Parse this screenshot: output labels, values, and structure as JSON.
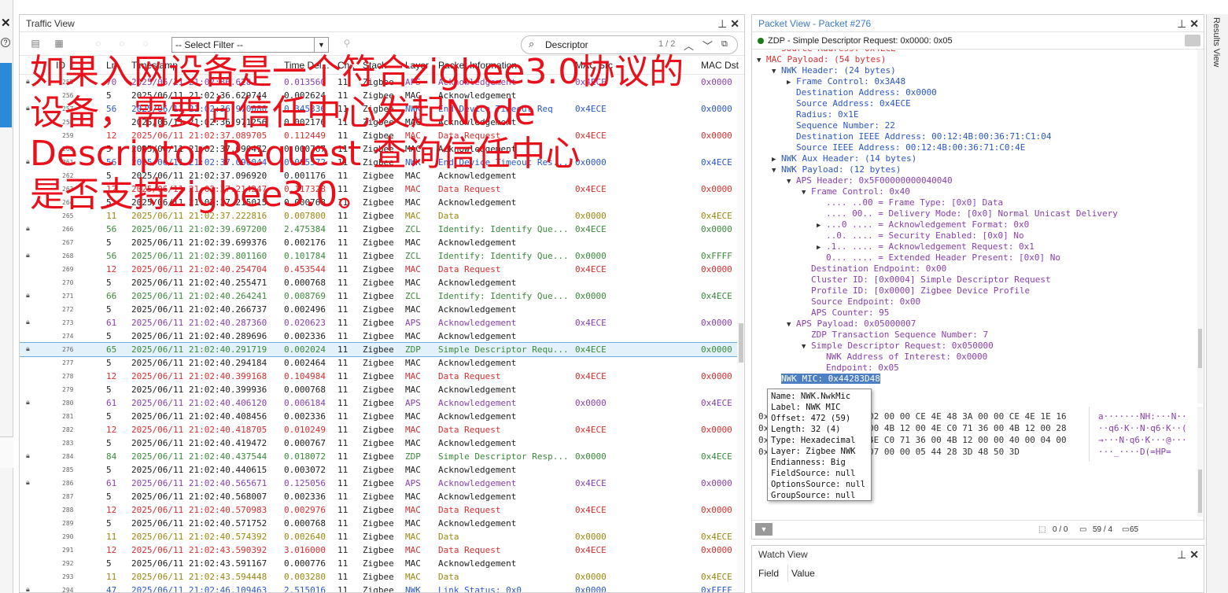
{
  "left_strip": {
    "close_top": "✕",
    "help": "?",
    "close_bottom": "✕"
  },
  "traffic_view": {
    "title": "Traffic View",
    "filter_value": "-- Select Filter --",
    "search_value": "Descriptor",
    "search_count": "1 / 2",
    "columns": [
      "ID",
      "Ln",
      "Timestamp",
      "Time Del...",
      "Ch..",
      "Stack",
      "Layer",
      "Packet Information",
      "MAC Src",
      "MAC Dst"
    ],
    "rows": [
      {
        "id": "255",
        "ln": "70",
        "ts": "2025/06/11 21:02:36.628",
        "td": "0.013560",
        "ch": "11",
        "stack": "Zigbee",
        "layer": "APS",
        "info": "Acknowledgement",
        "src": "0x4ECE",
        "dst": "0x0000",
        "color": "purple",
        "lock": true
      },
      {
        "id": "256",
        "ln": "5",
        "ts": "2025/06/11 21:02:36.629744",
        "td": "0.002624",
        "ch": "11",
        "stack": "Zigbee",
        "layer": "MAC",
        "info": "Acknowledgement",
        "src": "",
        "dst": "",
        "color": "black",
        "lock": false
      },
      {
        "id": "257",
        "ln": "56",
        "ts": "2025/06/11 21:02:36.970080",
        "td": "0.345336",
        "ch": "11",
        "stack": "Zigbee",
        "layer": "NWK",
        "info": "End Device Timeout Req",
        "src": "0x4ECE",
        "dst": "0x0000",
        "color": "blue",
        "lock": true
      },
      {
        "id": "258",
        "ln": "5",
        "ts": "2025/06/11 21:02:36.971256",
        "td": "0.002176",
        "ch": "11",
        "stack": "Zigbee",
        "layer": "MAC",
        "info": "Acknowledgement",
        "src": "",
        "dst": "",
        "color": "black",
        "lock": false
      },
      {
        "id": "259",
        "ln": "12",
        "ts": "2025/06/11 21:02:37.089705",
        "td": "0.112449",
        "ch": "11",
        "stack": "Zigbee",
        "layer": "MAC",
        "info": "Data Request",
        "src": "0x4ECE",
        "dst": "0x0000",
        "color": "red",
        "lock": false
      },
      {
        "id": "260",
        "ln": "5",
        "ts": "2025/06/11 21:02:37.090472",
        "td": "0.000767",
        "ch": "11",
        "stack": "Zigbee",
        "layer": "MAC",
        "info": "Acknowledgement",
        "src": "",
        "dst": "",
        "color": "black",
        "lock": false
      },
      {
        "id": "261",
        "ln": "56",
        "ts": "2025/06/11 21:02:37.096044",
        "td": "0.005572",
        "ch": "11",
        "stack": "Zigbee",
        "layer": "NWK",
        "info": "End Device Timeout Res...",
        "src": "0x0000",
        "dst": "0x4ECE",
        "color": "blue",
        "lock": true
      },
      {
        "id": "262",
        "ln": "5",
        "ts": "2025/06/11 21:02:37.096920",
        "td": "0.001176",
        "ch": "11",
        "stack": "Zigbee",
        "layer": "MAC",
        "info": "Acknowledgement",
        "src": "",
        "dst": "",
        "color": "black",
        "lock": false
      },
      {
        "id": "263",
        "ln": "12",
        "ts": "2025/06/11 21:02:37.214247",
        "td": "0.117328",
        "ch": "11",
        "stack": "Zigbee",
        "layer": "MAC",
        "info": "Data Request",
        "src": "0x4ECE",
        "dst": "0x0000",
        "color": "red",
        "lock": false
      },
      {
        "id": "264",
        "ln": "5",
        "ts": "2025/06/11 21:02:37.215015",
        "td": "0.000768",
        "ch": "11",
        "stack": "Zigbee",
        "layer": "MAC",
        "info": "Acknowledgement",
        "src": "",
        "dst": "",
        "color": "black",
        "lock": false
      },
      {
        "id": "265",
        "ln": "11",
        "ts": "2025/06/11 21:02:37.222816",
        "td": "0.007800",
        "ch": "11",
        "stack": "Zigbee",
        "layer": "MAC",
        "info": "Data",
        "src": "0x0000",
        "dst": "0x4ECE",
        "color": "olive",
        "lock": false
      },
      {
        "id": "266",
        "ln": "56",
        "ts": "2025/06/11 21:02:39.697200",
        "td": "2.475384",
        "ch": "11",
        "stack": "Zigbee",
        "layer": "ZCL",
        "info": "Identify: Identify Que...",
        "src": "0x4ECE",
        "dst": "0x0000",
        "color": "green",
        "lock": true
      },
      {
        "id": "267",
        "ln": "5",
        "ts": "2025/06/11 21:02:39.699376",
        "td": "0.002176",
        "ch": "11",
        "stack": "Zigbee",
        "layer": "MAC",
        "info": "Acknowledgement",
        "src": "",
        "dst": "",
        "color": "black",
        "lock": false
      },
      {
        "id": "268",
        "ln": "56",
        "ts": "2025/06/11 21:02:39.801160",
        "td": "0.101784",
        "ch": "11",
        "stack": "Zigbee",
        "layer": "ZCL",
        "info": "Identify: Identify Que...",
        "src": "0x0000",
        "dst": "0xFFFF",
        "color": "green",
        "lock": true
      },
      {
        "id": "269",
        "ln": "12",
        "ts": "2025/06/11 21:02:40.254704",
        "td": "0.453544",
        "ch": "11",
        "stack": "Zigbee",
        "layer": "MAC",
        "info": "Data Request",
        "src": "0x4ECE",
        "dst": "0x0000",
        "color": "red",
        "lock": false
      },
      {
        "id": "270",
        "ln": "5",
        "ts": "2025/06/11 21:02:40.255471",
        "td": "0.000768",
        "ch": "11",
        "stack": "Zigbee",
        "layer": "MAC",
        "info": "Acknowledgement",
        "src": "",
        "dst": "",
        "color": "black",
        "lock": false
      },
      {
        "id": "271",
        "ln": "66",
        "ts": "2025/06/11 21:02:40.264241",
        "td": "0.008769",
        "ch": "11",
        "stack": "Zigbee",
        "layer": "ZCL",
        "info": "Identify: Identify Que...",
        "src": "0x0000",
        "dst": "0x4ECE",
        "color": "green",
        "lock": true
      },
      {
        "id": "272",
        "ln": "5",
        "ts": "2025/06/11 21:02:40.266737",
        "td": "0.002496",
        "ch": "11",
        "stack": "Zigbee",
        "layer": "MAC",
        "info": "Acknowledgement",
        "src": "",
        "dst": "",
        "color": "black",
        "lock": false
      },
      {
        "id": "273",
        "ln": "61",
        "ts": "2025/06/11 21:02:40.287360",
        "td": "0.020623",
        "ch": "11",
        "stack": "Zigbee",
        "layer": "APS",
        "info": "Acknowledgement",
        "src": "0x4ECE",
        "dst": "0x0000",
        "color": "purple",
        "lock": true
      },
      {
        "id": "274",
        "ln": "5",
        "ts": "2025/06/11 21:02:40.289696",
        "td": "0.002336",
        "ch": "11",
        "stack": "Zigbee",
        "layer": "MAC",
        "info": "Acknowledgement",
        "src": "",
        "dst": "",
        "color": "black",
        "lock": false
      },
      {
        "id": "276",
        "ln": "65",
        "ts": "2025/06/11 21:02:40.291719",
        "td": "0.002024",
        "ch": "11",
        "stack": "Zigbee",
        "layer": "ZDP",
        "info": "Simple Descriptor Requ...",
        "src": "0x4ECE",
        "dst": "0x0000",
        "color": "green",
        "lock": true,
        "selected": true
      },
      {
        "id": "277",
        "ln": "5",
        "ts": "2025/06/11 21:02:40.294184",
        "td": "0.002464",
        "ch": "11",
        "stack": "Zigbee",
        "layer": "MAC",
        "info": "Acknowledgement",
        "src": "",
        "dst": "",
        "color": "black",
        "lock": false
      },
      {
        "id": "278",
        "ln": "12",
        "ts": "2025/06/11 21:02:40.399168",
        "td": "0.104984",
        "ch": "11",
        "stack": "Zigbee",
        "layer": "MAC",
        "info": "Data Request",
        "src": "0x4ECE",
        "dst": "0x0000",
        "color": "red",
        "lock": false
      },
      {
        "id": "279",
        "ln": "5",
        "ts": "2025/06/11 21:02:40.399936",
        "td": "0.000768",
        "ch": "11",
        "stack": "Zigbee",
        "layer": "MAC",
        "info": "Acknowledgement",
        "src": "",
        "dst": "",
        "color": "black",
        "lock": false
      },
      {
        "id": "280",
        "ln": "61",
        "ts": "2025/06/11 21:02:40.406120",
        "td": "0.006184",
        "ch": "11",
        "stack": "Zigbee",
        "layer": "APS",
        "info": "Acknowledgement",
        "src": "0x0000",
        "dst": "0x4ECE",
        "color": "purple",
        "lock": true
      },
      {
        "id": "281",
        "ln": "5",
        "ts": "2025/06/11 21:02:40.408456",
        "td": "0.002336",
        "ch": "11",
        "stack": "Zigbee",
        "layer": "MAC",
        "info": "Acknowledgement",
        "src": "",
        "dst": "",
        "color": "black",
        "lock": false
      },
      {
        "id": "282",
        "ln": "12",
        "ts": "2025/06/11 21:02:40.418705",
        "td": "0.010249",
        "ch": "11",
        "stack": "Zigbee",
        "layer": "MAC",
        "info": "Data Request",
        "src": "0x4ECE",
        "dst": "0x0000",
        "color": "red",
        "lock": false
      },
      {
        "id": "283",
        "ln": "5",
        "ts": "2025/06/11 21:02:40.419472",
        "td": "0.000767",
        "ch": "11",
        "stack": "Zigbee",
        "layer": "MAC",
        "info": "Acknowledgement",
        "src": "",
        "dst": "",
        "color": "black",
        "lock": false
      },
      {
        "id": "284",
        "ln": "84",
        "ts": "2025/06/11 21:02:40.437544",
        "td": "0.018072",
        "ch": "11",
        "stack": "Zigbee",
        "layer": "ZDP",
        "info": "Simple Descriptor Resp...",
        "src": "0x0000",
        "dst": "0x4ECE",
        "color": "green",
        "lock": true
      },
      {
        "id": "285",
        "ln": "5",
        "ts": "2025/06/11 21:02:40.440615",
        "td": "0.003072",
        "ch": "11",
        "stack": "Zigbee",
        "layer": "MAC",
        "info": "Acknowledgement",
        "src": "",
        "dst": "",
        "color": "black",
        "lock": false
      },
      {
        "id": "286",
        "ln": "61",
        "ts": "2025/06/11 21:02:40.565671",
        "td": "0.125056",
        "ch": "11",
        "stack": "Zigbee",
        "layer": "APS",
        "info": "Acknowledgement",
        "src": "0x4ECE",
        "dst": "0x0000",
        "color": "purple",
        "lock": true
      },
      {
        "id": "287",
        "ln": "5",
        "ts": "2025/06/11 21:02:40.568007",
        "td": "0.002336",
        "ch": "11",
        "stack": "Zigbee",
        "layer": "MAC",
        "info": "Acknowledgement",
        "src": "",
        "dst": "",
        "color": "black",
        "lock": false
      },
      {
        "id": "288",
        "ln": "12",
        "ts": "2025/06/11 21:02:40.570983",
        "td": "0.002976",
        "ch": "11",
        "stack": "Zigbee",
        "layer": "MAC",
        "info": "Data Request",
        "src": "0x4ECE",
        "dst": "0x0000",
        "color": "red",
        "lock": false
      },
      {
        "id": "289",
        "ln": "5",
        "ts": "2025/06/11 21:02:40.571752",
        "td": "0.000768",
        "ch": "11",
        "stack": "Zigbee",
        "layer": "MAC",
        "info": "Acknowledgement",
        "src": "",
        "dst": "",
        "color": "black",
        "lock": false
      },
      {
        "id": "290",
        "ln": "11",
        "ts": "2025/06/11 21:02:40.574392",
        "td": "0.002640",
        "ch": "11",
        "stack": "Zigbee",
        "layer": "MAC",
        "info": "Data",
        "src": "0x0000",
        "dst": "0x4ECE",
        "color": "olive",
        "lock": false
      },
      {
        "id": "291",
        "ln": "12",
        "ts": "2025/06/11 21:02:43.590392",
        "td": "3.016000",
        "ch": "11",
        "stack": "Zigbee",
        "layer": "MAC",
        "info": "Data Request",
        "src": "0x4ECE",
        "dst": "0x0000",
        "color": "red",
        "lock": false
      },
      {
        "id": "292",
        "ln": "5",
        "ts": "2025/06/11 21:02:43.591167",
        "td": "0.000776",
        "ch": "11",
        "stack": "Zigbee",
        "layer": "MAC",
        "info": "Acknowledgement",
        "src": "",
        "dst": "",
        "color": "black",
        "lock": false
      },
      {
        "id": "293",
        "ln": "11",
        "ts": "2025/06/11 21:02:43.594448",
        "td": "0.003280",
        "ch": "11",
        "stack": "Zigbee",
        "layer": "MAC",
        "info": "Data",
        "src": "0x0000",
        "dst": "0x4ECE",
        "color": "olive",
        "lock": false
      },
      {
        "id": "294",
        "ln": "47",
        "ts": "2025/06/11 21:02:46.109463",
        "td": "2.515016",
        "ch": "11",
        "stack": "Zigbee",
        "layer": "NWK",
        "info": "Link Status: 0x0",
        "src": "0x0000",
        "dst": "0xFFFF",
        "color": "blue",
        "lock": true
      }
    ]
  },
  "overlay": {
    "lines": [
      "如果入网设备是一个符合zigbee3.0协议的",
      "设备，需要向信任中心发起Node",
      "Descriptor Request 查询信任中心",
      "是否支持zigbee3.0。"
    ]
  },
  "packet_view": {
    "title": "Packet View - Packet #276",
    "subtitle": "ZDP - Simple Descriptor Request: 0x0000: 0x05",
    "tree": [
      {
        "t": "Source Address: 0x4ECE",
        "lvl": 1,
        "arr": "",
        "c": "red"
      },
      {
        "t": "MAC Payload: (54 bytes)",
        "lvl": 0,
        "arr": "▼",
        "c": "red"
      },
      {
        "t": "NWK Header: (24 bytes)",
        "lvl": 1,
        "arr": "▼",
        "c": "blue"
      },
      {
        "t": "Frame Control: 0x3A48",
        "lvl": 2,
        "arr": "▶",
        "c": "blue"
      },
      {
        "t": "Destination Address: 0x0000",
        "lvl": 2,
        "arr": "",
        "c": "blue"
      },
      {
        "t": "Source Address: 0x4ECE",
        "lvl": 2,
        "arr": "",
        "c": "blue"
      },
      {
        "t": "Radius: 0x1E",
        "lvl": 2,
        "arr": "",
        "c": "blue"
      },
      {
        "t": "Sequence Number: 22",
        "lvl": 2,
        "arr": "",
        "c": "blue"
      },
      {
        "t": "Destination IEEE Address: 00:12:4B:00:36:71:C1:04",
        "lvl": 2,
        "arr": "",
        "c": "blue"
      },
      {
        "t": "Source IEEE Address: 00:12:4B:00:36:71:C0:4E",
        "lvl": 2,
        "arr": "",
        "c": "blue"
      },
      {
        "t": "NWK Aux Header: (14 bytes)",
        "lvl": 1,
        "arr": "▶",
        "c": "blue"
      },
      {
        "t": "NWK Payload: (12 bytes)",
        "lvl": 1,
        "arr": "▼",
        "c": "blue"
      },
      {
        "t": "APS Header: 0x5F00000000040040",
        "lvl": 2,
        "arr": "▼",
        "c": "purple"
      },
      {
        "t": "Frame Control: 0x40",
        "lvl": 3,
        "arr": "▼",
        "c": "purple"
      },
      {
        "t": ".... ..00 = Frame Type: [0x0] Data",
        "lvl": 4,
        "arr": "",
        "c": "purple"
      },
      {
        "t": ".... 00.. = Delivery Mode: [0x0] Normal Unicast Delivery",
        "lvl": 4,
        "arr": "",
        "c": "purple"
      },
      {
        "t": "...0 .... = Acknowledgement Format: 0x0",
        "lvl": 4,
        "arr": "▶",
        "c": "purple"
      },
      {
        "t": "..0. .... = Security Enabled: [0x0] No",
        "lvl": 4,
        "arr": "",
        "c": "purple"
      },
      {
        "t": ".1.. .... = Acknowledgement Request: 0x1",
        "lvl": 4,
        "arr": "▶",
        "c": "purple"
      },
      {
        "t": "0... .... = Extended Header Present: [0x0] No",
        "lvl": 4,
        "arr": "",
        "c": "purple"
      },
      {
        "t": "Destination Endpoint: 0x00",
        "lvl": 3,
        "arr": "",
        "c": "purple"
      },
      {
        "t": "Cluster ID: [0x0004] Simple Descriptor Request",
        "lvl": 3,
        "arr": "",
        "c": "purple"
      },
      {
        "t": "Profile ID: [0x0000] Zigbee Device Profile",
        "lvl": 3,
        "arr": "",
        "c": "purple"
      },
      {
        "t": "Source Endpoint: 0x00",
        "lvl": 3,
        "arr": "",
        "c": "purple"
      },
      {
        "t": "APS Counter: 95",
        "lvl": 3,
        "arr": "",
        "c": "purple"
      },
      {
        "t": "APS Payload: 0x05000007",
        "lvl": 2,
        "arr": "▼",
        "c": "purple"
      },
      {
        "t": "ZDP Transaction Sequence Number: 7",
        "lvl": 3,
        "arr": "",
        "c": "purple"
      },
      {
        "t": "Simple Descriptor Request: 0x050000",
        "lvl": 3,
        "arr": "▼",
        "c": "purple"
      },
      {
        "t": "NWK Address of Interest: 0x0000",
        "lvl": 4,
        "arr": "",
        "c": "purple"
      },
      {
        "t": "Endpoint: 0x05",
        "lvl": 4,
        "arr": "",
        "c": "purple"
      },
      {
        "t": "NWK MIC: 0x44283D48",
        "lvl": 1,
        "arr": "",
        "c": "highlight"
      }
    ],
    "hex": {
      "lines": [
        "02 00 00 CE 4E 48 3A 00 00 CE 4E 1E 16",
        "00 4B 12 00 4E C0 71 36 00 4B 12 00 28",
        "4E C0 71 36 00 4B 12 00 00 40 00 04 00",
        "07 00 00 05 44 28 3D 48 50 3D"
      ],
      "ascii": [
        "a·······NH:···N··",
        "··q6·K··N·q6·K··(",
        "→···N·q6·K···@···",
        "···_····D(=HP="
      ]
    },
    "tooltip": [
      "Name: NWK.NwkMic",
      "Label: NWK MIC",
      "Offset: 472 (59)",
      "Length: 32 (4)",
      "Type: Hexadecimal",
      "Layer: Zigbee NWK",
      "Endianness: Big",
      "FieldSource: null",
      "OptionsSource: null",
      "GroupSource: null"
    ],
    "footer": {
      "a": "0 / 0",
      "b": "59 / 4",
      "c": "65"
    }
  },
  "watch_view": {
    "title": "Watch View",
    "col_field": "Field",
    "col_value": "Value"
  },
  "results_view": {
    "title": "Results View"
  }
}
